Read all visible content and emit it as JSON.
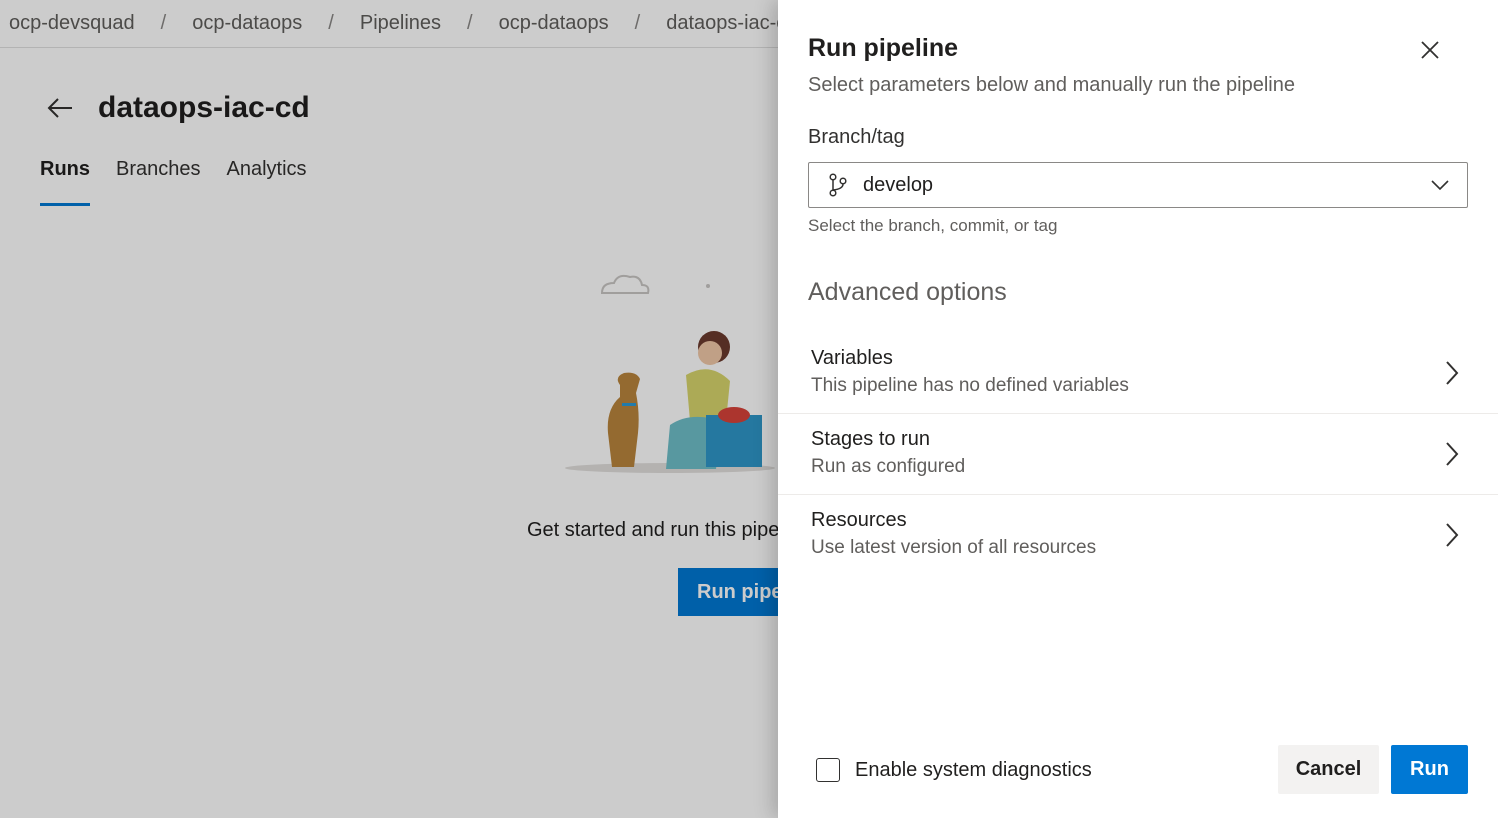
{
  "breadcrumb": {
    "items": [
      "ocp-devsquad",
      "ocp-dataops",
      "Pipelines",
      "ocp-dataops",
      "dataops-iac-cd"
    ],
    "separator": "/"
  },
  "page": {
    "title": "dataops-iac-cd",
    "tabs": [
      {
        "label": "Runs",
        "active": true
      },
      {
        "label": "Branches",
        "active": false
      },
      {
        "label": "Analytics",
        "active": false
      }
    ],
    "empty_state_text": "Get started and run this pipeline for the first time!",
    "run_button_label": "Run pipeline"
  },
  "panel": {
    "title": "Run pipeline",
    "subtitle": "Select parameters below and manually run the pipeline",
    "branch_label": "Branch/tag",
    "branch_value": "develop",
    "branch_help": "Select the branch, commit, or tag",
    "advanced_title": "Advanced options",
    "options": [
      {
        "title": "Variables",
        "description": "This pipeline has no defined variables"
      },
      {
        "title": "Stages to run",
        "description": "Run as configured"
      },
      {
        "title": "Resources",
        "description": "Use latest version of all resources"
      }
    ],
    "diagnostics_label": "Enable system diagnostics",
    "diagnostics_checked": false,
    "cancel_label": "Cancel",
    "run_label": "Run"
  },
  "colors": {
    "accent": "#0078d4",
    "overlay": "rgba(0,0,0,0.2)"
  },
  "icons": {
    "back": "arrow-left-icon",
    "close": "close-icon",
    "branch": "git-branch-icon",
    "dropdown": "chevron-down-icon",
    "option": "chevron-right-icon"
  }
}
